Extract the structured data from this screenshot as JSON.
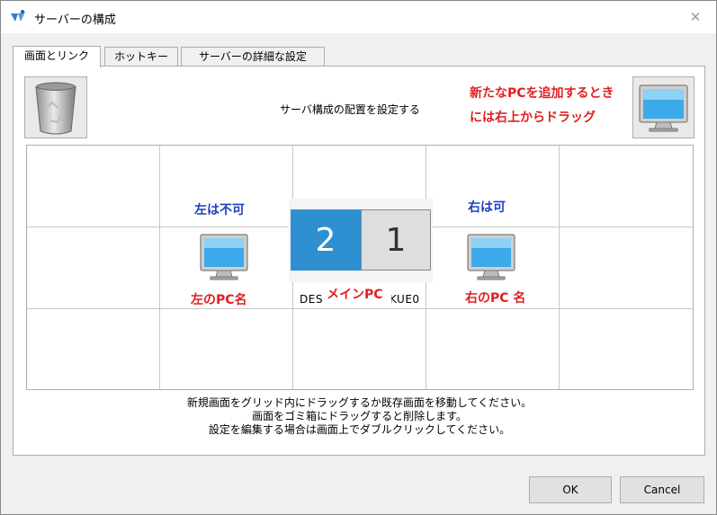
{
  "window": {
    "title": "サーバーの構成"
  },
  "tabs": [
    {
      "label": "画面とリンク",
      "active": true
    },
    {
      "label": "ホットキー",
      "active": false
    },
    {
      "label": "サーバーの詳細な設定",
      "active": false
    }
  ],
  "config_label": "サーバ構成の配置を設定する",
  "annotations": {
    "add_line1": "新たなPCを追加するとき",
    "add_line2": "には右上からドラッグ",
    "left_disallowed": "左は不可",
    "right_allowed": "右は可",
    "left_pc_name": "左のPC名",
    "right_pc_name": "右のPC 名",
    "main_pc": "メインPC"
  },
  "screens": {
    "left_number": "2",
    "right_number": "1"
  },
  "main_pc_name_left": "DES",
  "main_pc_name_right": "KUE0",
  "help": {
    "line1": "新規画面をグリッド内にドラッグするか既存画面を移動してください。",
    "line2": "画面をゴミ箱にドラッグすると削除します。",
    "line3": "設定を編集する場合は画面上でダブルクリックしてください。"
  },
  "buttons": {
    "ok": "OK",
    "cancel": "Cancel"
  },
  "colors": {
    "annotation_red": "#e02020",
    "annotation_blue": "#1f3fbf",
    "selected_screen": "#2e8fd1"
  },
  "icons": {
    "app": "network-app-icon",
    "close": "close-icon",
    "trash": "recycle-bin-icon",
    "monitor": "monitor-icon"
  }
}
